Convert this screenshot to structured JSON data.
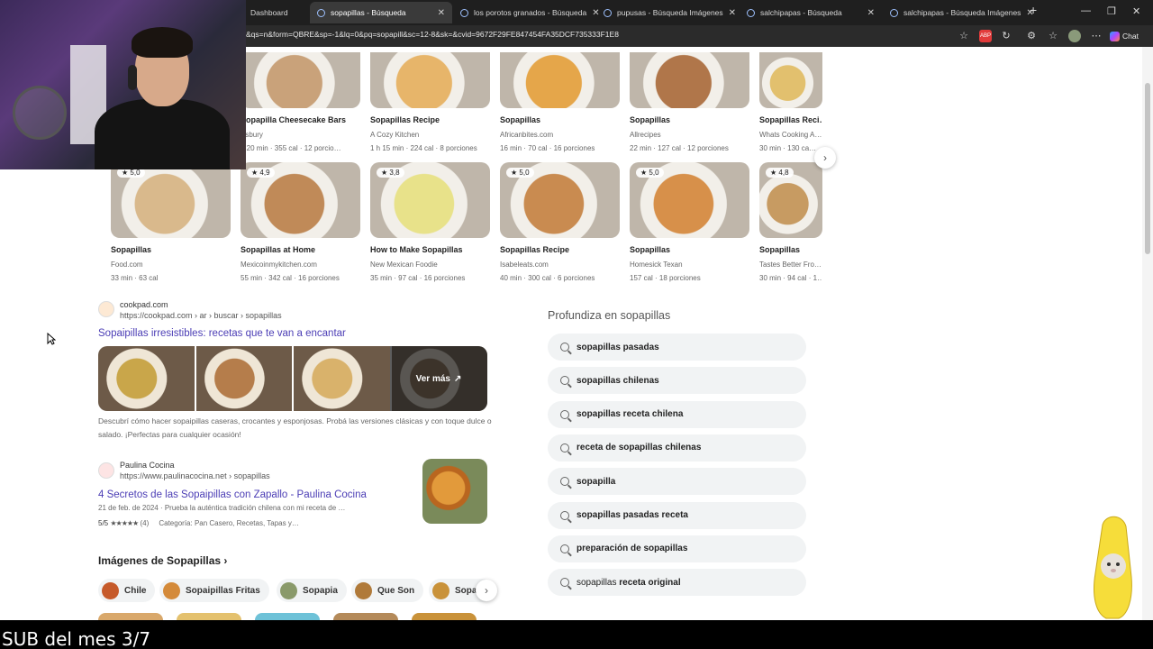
{
  "browser": {
    "tabs": [
      {
        "label": "Dashboard",
        "active": false
      },
      {
        "label": "sopapillas - Búsqueda",
        "active": true
      },
      {
        "label": "los porotos granados - Búsqueda",
        "active": false
      },
      {
        "label": "pupusas - Búsqueda Imágenes",
        "active": false
      },
      {
        "label": "salchipapas - Búsqueda",
        "active": false
      },
      {
        "label": "salchipapas - Búsqueda Imágenes",
        "active": false
      }
    ],
    "url": "&qs=n&form=QBRE&sp=-1&lq=0&pq=sopapill&sc=12-8&sk=&cvid=9672F29FE847454FA35DCF735333F1E8",
    "chat_label": "Chat"
  },
  "recipes_row1": [
    {
      "title": "Sopapilla Cheesecake Bars",
      "source": "illsbury",
      "meta": "h 20 min · 355 cal · 12 porcio…",
      "color": "#c9a27a"
    },
    {
      "title": "Sopapillas Recipe",
      "source": "A Cozy Kitchen",
      "meta": "1 h 15 min · 224 cal · 8 porciones",
      "color": "#e7b56a"
    },
    {
      "title": "Sopapillas",
      "source": "Africanbites.com",
      "meta": "16 min · 70 cal · 16 porciones",
      "color": "#e5a64a"
    },
    {
      "title": "Sopapillas",
      "source": "Allrecipes",
      "meta": "22 min · 127 cal · 12 porciones",
      "color": "#b0764a"
    },
    {
      "title": "Sopapillas Reci…",
      "source": "Whats Cooking A…",
      "meta": "30 min · 130 ca…",
      "color": "#e2c06e"
    }
  ],
  "recipes_row2": [
    {
      "rating": "5,0",
      "title": "Sopapillas",
      "source": "Food.com",
      "meta": "33 min · 63 cal",
      "color": "#d9b98c"
    },
    {
      "rating": "4,9",
      "title": "Sopapillas at Home",
      "source": "Mexicoinmykitchen.com",
      "meta": "55 min · 342 cal · 16 porciones",
      "color": "#c08a58"
    },
    {
      "rating": "3,8",
      "title": "How to Make Sopapillas",
      "source": "New Mexican Foodie",
      "meta": "35 min · 97 cal · 16 porciones",
      "color": "#e8e28a"
    },
    {
      "rating": "5,0",
      "title": "Sopapillas Recipe",
      "source": "Isabeleats.com",
      "meta": "40 min · 300 cal · 6 porciones",
      "color": "#c98b50"
    },
    {
      "rating": "5,0",
      "title": "Sopapillas",
      "source": "Homesick Texan",
      "meta": "157 cal · 18 porciones",
      "color": "#d7904a"
    },
    {
      "rating": "4,8",
      "title": "Sopapillas",
      "source": "Tastes Better Fro…",
      "meta": "30 min · 94 cal · 1…",
      "color": "#c79b62"
    }
  ],
  "result_cookpad": {
    "site": "cookpad.com",
    "url": "https://cookpad.com › ar › buscar › sopapillas",
    "title": "Sopaipillas irresistibles: recetas que te van a encantar",
    "more_label": "Ver más",
    "snippet": "Descubrí cómo hacer sopaipillas caseras, crocantes y esponjosas. Probá las versiones clásicas y con toque dulce o salado. ¡Perfectas para cualquier ocasión!",
    "strip_colors": [
      "#c9a64a",
      "#b57d4b",
      "#d9b26b",
      "#8a6a4a"
    ]
  },
  "result_paulina": {
    "site": "Paulina Cocina",
    "url": "https://www.paulinacocina.net › sopapillas",
    "title": "4 Secretos de las Sopaipillas con Zapallo - Paulina Cocina",
    "date_snippet": "21 de feb. de 2024 · Prueba la auténtica tradición chilena con mi receta de …",
    "rating": "5/5",
    "stars": "★★★★★",
    "count": "(4)",
    "category": "Categoría: Pan Casero, Recetas, Tapas y…"
  },
  "images_section": {
    "heading": "Imágenes de Sopapillas",
    "chips": [
      {
        "label": "Chile",
        "color": "#c65a2a"
      },
      {
        "label": "Sopaipillas Fritas",
        "color": "#d48a3a"
      },
      {
        "label": "Sopapia",
        "color": "#8a9a6a"
      },
      {
        "label": "Que Son",
        "color": "#b07a3a"
      },
      {
        "label": "Sopa",
        "color": "#c9923a"
      }
    ]
  },
  "related": {
    "heading": "Profundiza en sopapillas",
    "items": [
      {
        "prefix": "",
        "bold": "sopapillas pasadas"
      },
      {
        "prefix": "",
        "bold": "sopapillas chilenas"
      },
      {
        "prefix": "",
        "bold": "sopapillas receta chilena"
      },
      {
        "prefix": "",
        "bold": "receta de sopapillas chilenas"
      },
      {
        "prefix": "",
        "bold": "sopapilla"
      },
      {
        "prefix": "",
        "bold": "sopapillas pasadas receta"
      },
      {
        "prefix": "",
        "bold": "preparación de sopapillas"
      },
      {
        "prefix": "sopapillas ",
        "bold": "receta original"
      }
    ]
  },
  "overlay": {
    "sub_text": "SUB del mes 3/7"
  }
}
